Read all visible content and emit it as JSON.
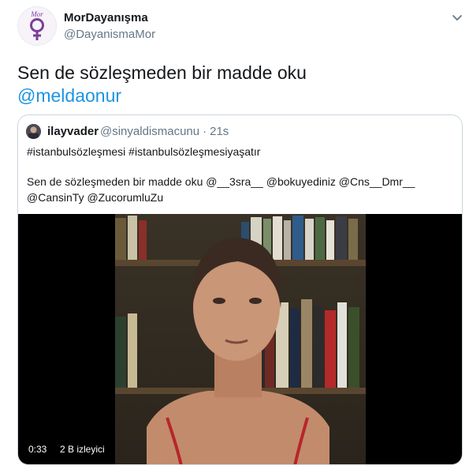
{
  "tweet": {
    "author": {
      "display_name": "MorDayanışma",
      "handle": "@DayanismaMor",
      "avatar_icon": "venus-symbol-logo",
      "avatar_logo_text": "Mor"
    },
    "text": "Sen de sözleşmeden bir madde oku",
    "mention": "@meldaonur",
    "menu_icon": "chevron-down-icon",
    "quoted": {
      "display_name": "ilayvader",
      "handle": "@sinyaldismacunu",
      "separator": "·",
      "time": "21s",
      "hashtags": "#istanbulsözleşmesi #istanbulsözleşmesiyaşatır",
      "body_line1": "Sen de sözleşmeden bir madde oku @__3sra__ @bokuyediniz @Cns__Dmr__",
      "body_line2": "@CansinTy @ZucorumluZu",
      "video": {
        "time": "0:33",
        "views": "2 B izleyici"
      }
    }
  },
  "colors": {
    "link": "#1b95e0",
    "secondary_text": "#657786",
    "border": "#ccd6dd",
    "brand_purple": "#7b3f98"
  }
}
